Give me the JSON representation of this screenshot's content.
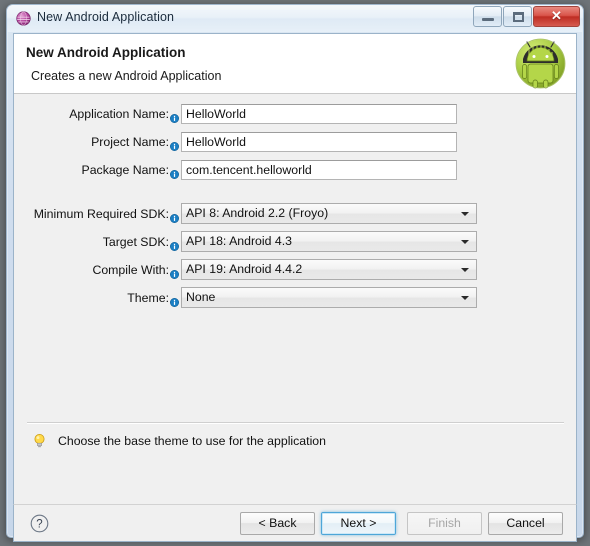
{
  "window": {
    "title": "New Android Application",
    "icon": "eclipse-sphere-icon",
    "controls": {
      "minimize": "minimize-button",
      "maximize": "maximize-button",
      "close_glyph": "✕"
    }
  },
  "header": {
    "title": "New Android Application",
    "subtitle": "Creates a new Android Application",
    "badge_icon": "android-robot-icon"
  },
  "form": {
    "text_fields": [
      {
        "label": "Application Name:",
        "value": "HelloWorld",
        "placeholder": "",
        "info_icon": "info-icon"
      },
      {
        "label": "Project Name:",
        "value": "HelloWorld",
        "placeholder": "",
        "info_icon": "info-icon"
      },
      {
        "label": "Package Name:",
        "value": "com.tencent.helloworld",
        "placeholder": "",
        "info_icon": "info-icon"
      }
    ],
    "combos": [
      {
        "label": "Minimum Required SDK:",
        "value": "API 8: Android 2.2 (Froyo)",
        "info_icon": "info-icon"
      },
      {
        "label": "Target SDK:",
        "value": "API 18: Android 4.3",
        "info_icon": "info-icon"
      },
      {
        "label": "Compile With:",
        "value": "API 19: Android 4.4.2",
        "info_icon": "info-icon"
      },
      {
        "label": "Theme:",
        "value": "None",
        "info_icon": "info-icon"
      }
    ]
  },
  "hint": {
    "icon": "lightbulb-icon",
    "text": "Choose the base theme to use for the application"
  },
  "buttons": {
    "help": "?",
    "back": "< Back",
    "next": "Next >",
    "finish": "Finish",
    "cancel": "Cancel"
  },
  "colors": {
    "titlebar_accent": "#dfeaf5",
    "close_button": "#bf2d23",
    "focus_blue": "#4ea6d8",
    "android_green": "#a4c639",
    "eclipse_purple": "#a5408f",
    "dialog_bg": "#f0f0f0"
  }
}
